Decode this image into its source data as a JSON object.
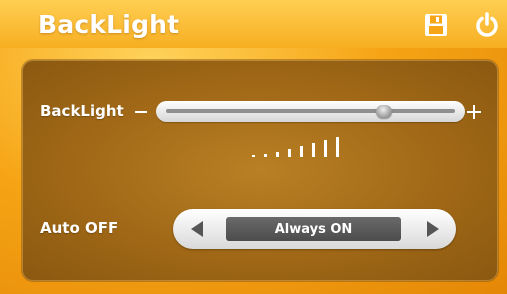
{
  "header": {
    "title": "BackLight",
    "icons": [
      "save-icon",
      "power-icon"
    ]
  },
  "backlight": {
    "label": "BackLight",
    "level": 0.76,
    "minus_symbol": "−",
    "plus_symbol": "+",
    "scale_marks": 8
  },
  "auto_off": {
    "label": "Auto OFF",
    "value": "Always ON",
    "left_arrow_icon": "arrow-left-icon",
    "right_arrow_icon": "arrow-right-icon"
  },
  "colors": {
    "background": "#f5a21a",
    "panel": "#9f6716",
    "text": "#ffffff",
    "control": "#5a5a5a"
  }
}
